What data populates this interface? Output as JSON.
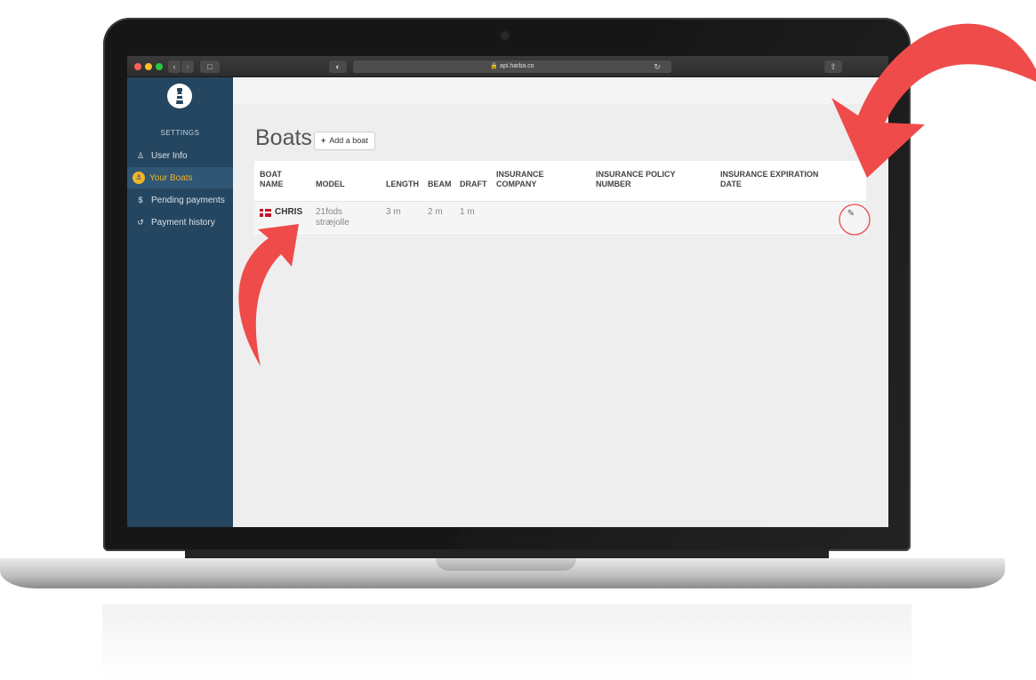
{
  "browser": {
    "url": "🔒 api.harba.co"
  },
  "sidebar": {
    "title": "SETTINGS",
    "items": [
      {
        "icon": "user-icon",
        "glyph": "♙",
        "label": "User Info"
      },
      {
        "icon": "boat-icon",
        "glyph": "⚓",
        "label": "Your Boats",
        "active": true
      },
      {
        "icon": "dollar-icon",
        "glyph": "$",
        "label": "Pending payments"
      },
      {
        "icon": "history-icon",
        "glyph": "↺",
        "label": "Payment history"
      }
    ]
  },
  "main": {
    "title": "Boats",
    "add_button": {
      "plus": "+",
      "label": "Add a boat"
    },
    "table": {
      "headers": {
        "boat_name_1": "BOAT",
        "boat_name_2": "NAME",
        "model": "MODEL",
        "length": "LENGTH",
        "beam": "BEAM",
        "draft": "DRAFT",
        "insurance_company_1": "INSURANCE",
        "insurance_company_2": "COMPANY",
        "policy_1": "INSURANCE POLICY",
        "policy_2": "NUMBER",
        "expiration_1": "INSURANCE EXPIRATION",
        "expiration_2": "DATE"
      },
      "rows": [
        {
          "flag": "denmark-flag-icon",
          "name": "CHRIS",
          "model_1": "21fods",
          "model_2": "stræjolle",
          "length": "3 m",
          "beam": "2 m",
          "draft": "1 m",
          "edit_glyph": "✎"
        }
      ]
    }
  },
  "colors": {
    "sidebar_bg": "#254660",
    "active_accent": "#f0b429",
    "annotation_red": "#ef4b4b",
    "flag_red": "#c8102e"
  }
}
